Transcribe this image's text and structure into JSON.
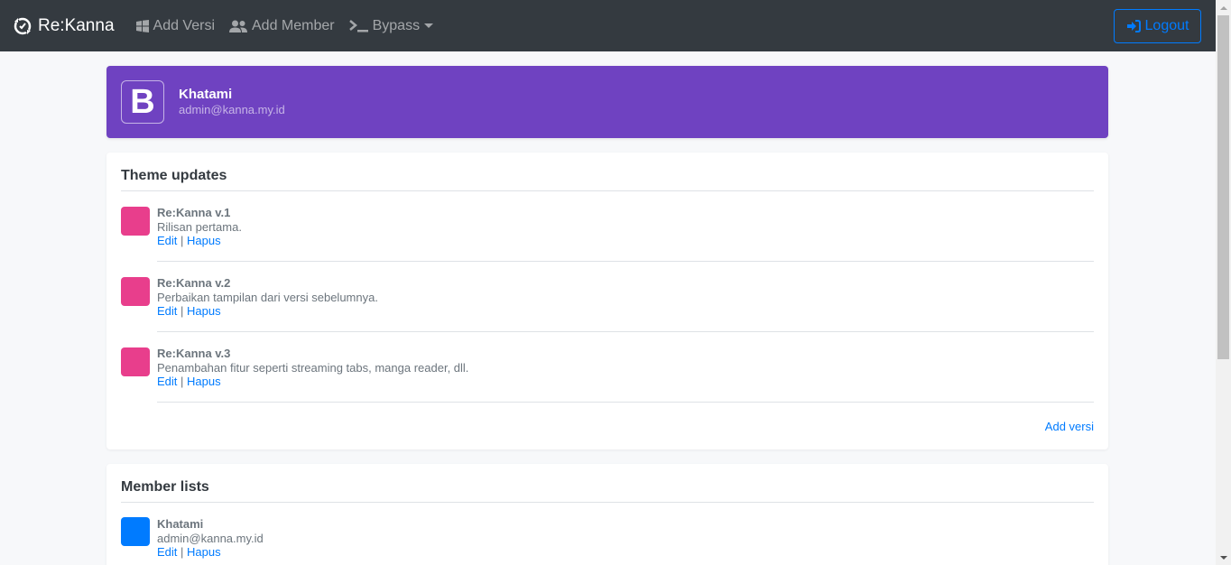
{
  "navbar": {
    "brand": "Re:Kanna",
    "items": [
      {
        "label": "Add Versi",
        "icon": "windows-icon"
      },
      {
        "label": "Add Member",
        "icon": "users-icon"
      },
      {
        "label": "Bypass",
        "icon": "terminal-icon"
      }
    ],
    "logout": "Logout"
  },
  "profile": {
    "logo_letter": "B",
    "name": "Khatami",
    "email": "admin@kanna.my.id"
  },
  "theme_updates": {
    "title": "Theme updates",
    "items": [
      {
        "title": "Re:Kanna v.1",
        "desc": "Rilisan pertama.",
        "edit": "Edit",
        "sep": "|",
        "delete": "Hapus",
        "color": "#e83e8c"
      },
      {
        "title": "Re:Kanna v.2",
        "desc": "Perbaikan tampilan dari versi sebelumnya.",
        "edit": "Edit",
        "sep": "|",
        "delete": "Hapus",
        "color": "#e83e8c"
      },
      {
        "title": "Re:Kanna v.3",
        "desc": "Penambahan fitur seperti streaming tabs, manga reader, dll.",
        "edit": "Edit",
        "sep": "|",
        "delete": "Hapus",
        "color": "#e83e8c"
      }
    ],
    "add_link": "Add versi"
  },
  "member_lists": {
    "title": "Member lists",
    "items": [
      {
        "name": "Khatami",
        "email": "admin@kanna.my.id",
        "edit": "Edit",
        "sep": "|",
        "delete": "Hapus",
        "color": "#007bff"
      }
    ]
  },
  "colors": {
    "navbar": "#343a40",
    "profile": "#6f42c1",
    "accent": "#007bff",
    "pink": "#e83e8c"
  }
}
